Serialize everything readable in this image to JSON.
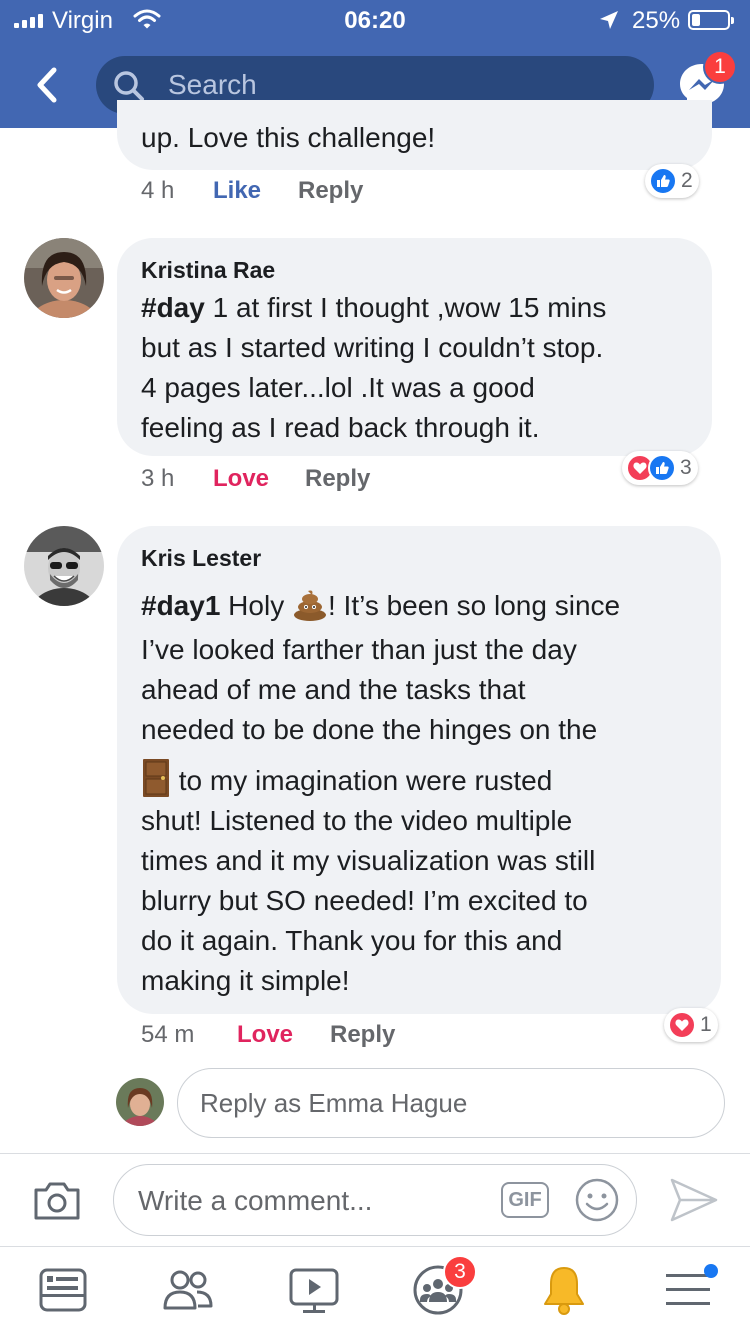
{
  "status_bar": {
    "carrier": "Virgin",
    "time": "06:20",
    "battery": "25%",
    "battery_level": 0.25
  },
  "header": {
    "search_placeholder": "Search",
    "messenger_badge": "1"
  },
  "comments": [
    {
      "text_tail": "up.  Love this challenge!",
      "time": "4 h",
      "action": "Like",
      "reply": "Reply",
      "reactions": [
        "like"
      ],
      "reaction_count": "2"
    },
    {
      "author": "Kristina Rae",
      "hashtag": "#day",
      "lines": [
        " 1 at first I thought ,wow 15 mins",
        "but as I started writing I couldn’t stop.",
        "4 pages later...lol .It was a good",
        "feeling as I read back through it."
      ],
      "time": "3 h",
      "action": "Love",
      "reply": "Reply",
      "reactions": [
        "love",
        "like"
      ],
      "reaction_count": "3"
    },
    {
      "author": "Kris Lester",
      "hashtag": "#day1",
      "line1_a": " Holy ",
      "line1_b": "! It’s been so long since",
      "lines_a": [
        "I’ve looked farther than just the day",
        "ahead of me and the tasks that",
        "needed to be done the hinges on the"
      ],
      "door_line": " to my imagination were rusted",
      "lines_b": [
        "shut! Listened to the video multiple",
        "times and it my visualization was still",
        "blurry but SO needed! I’m excited to",
        "do it again. Thank you for this and",
        "making it simple!"
      ],
      "time": "54 m",
      "action": "Love",
      "reply": "Reply",
      "reactions": [
        "love"
      ],
      "reaction_count": "1"
    }
  ],
  "reply_box": {
    "placeholder": "Reply as Emma Hague"
  },
  "composer": {
    "placeholder": "Write a comment...",
    "gif_label": "GIF"
  },
  "bottom_nav": {
    "groups_badge": "3"
  },
  "colors": {
    "header_blue": "#4267b2",
    "like_blue": "#4267b2",
    "love_red": "#e0245e",
    "bubble_gray": "#f0f2f5"
  }
}
